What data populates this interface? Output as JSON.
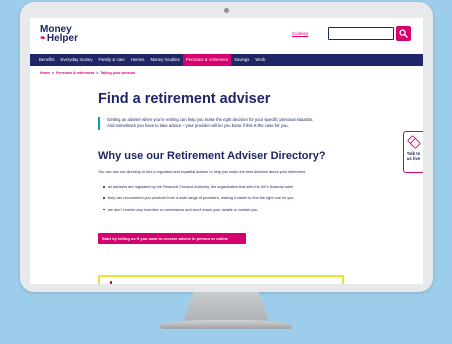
{
  "header": {
    "logo_line1": "Money",
    "logo_line2": "Helper",
    "cookies_label": "Cookies",
    "search_placeholder": ""
  },
  "nav": {
    "items": [
      {
        "label": "Benefits",
        "active": false
      },
      {
        "label": "Everyday money",
        "active": false
      },
      {
        "label": "Family & care",
        "active": false
      },
      {
        "label": "Homes",
        "active": false
      },
      {
        "label": "Money troubles",
        "active": false
      },
      {
        "label": "Pensions & retirement",
        "active": true
      },
      {
        "label": "Savings",
        "active": false
      },
      {
        "label": "Work",
        "active": false
      }
    ]
  },
  "breadcrumb": {
    "home": "Home",
    "section": "Pensions & retirement",
    "current": "Taking your pension",
    "separator": ">"
  },
  "main": {
    "title": "Find a retirement adviser",
    "intro_line1": "Getting an adviser when you’re retiring can help you make the right decision for your specific personal situation.",
    "intro_line2": "And sometimes you have to take advice – your provider will let you know if this is the case for you.",
    "subtitle": "Why use our Retirement Adviser Directory?",
    "paragraph": "You can use our directory to find a regulated and impartial adviser to help you make the best decision about your retirement.",
    "bullets": [
      "all advisers are regulated by the Financial Conduct Authority, the organisation that sets the UK’s financial rules",
      "they can recommend you products from a wide range of providers, making it easier to find the right one for you",
      "we don’t receive any incentive or commission and won’t share your details or contact you."
    ],
    "cta_label": "Start by telling us if you want to receive advice in person or online"
  },
  "chat": {
    "line1": "Talk to",
    "line2": "us live"
  },
  "colors": {
    "brand_navy": "#1f2667",
    "brand_pink": "#d6006f",
    "accent_teal": "#00a2b5",
    "highlight_yellow": "#f0e233",
    "background_blue": "#9ccdea"
  },
  "icons": {
    "search": "search-icon",
    "chat": "chat-bubbles-icon",
    "logo_mark": "swirl-icon"
  }
}
